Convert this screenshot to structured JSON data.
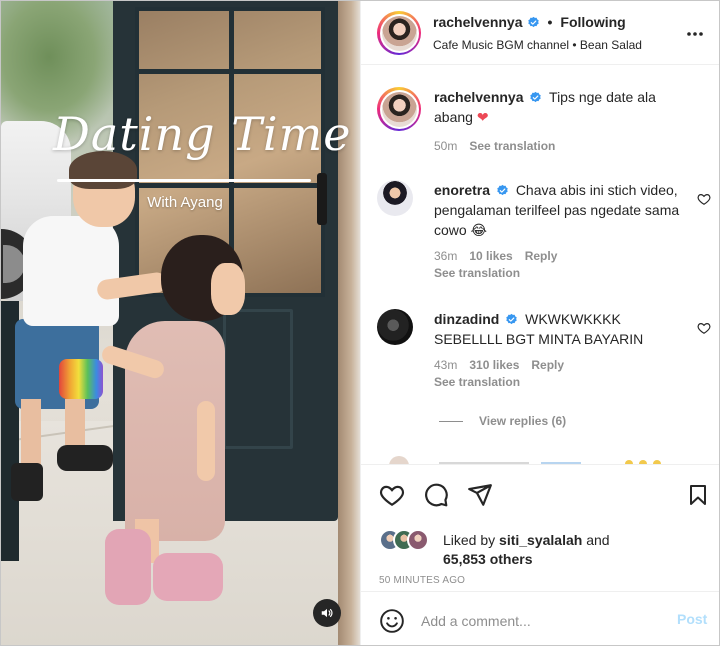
{
  "video": {
    "title": "Dating Time",
    "subtitle": "With Ayang",
    "mute_icon": "speaker-icon"
  },
  "header": {
    "username": "rachelvennyа",
    "separator": "•",
    "follow_label": "Following",
    "audio_line": "Cafe Music BGM channel • Bean Salad",
    "more_icon": "more-horizontal-icon"
  },
  "caption": {
    "username": "rachelvennya",
    "text": "Tips nge date ala abang",
    "emoji": "❤",
    "time": "50m",
    "see_translation": "See translation"
  },
  "comments": [
    {
      "username": "enoretra",
      "text": "Chava abis ini stich video, pengalaman terilfeel pas ngedate sama cowo",
      "emoji": "😂",
      "time": "36m",
      "likes": "10 likes",
      "reply": "Reply",
      "see_translation": "See translation"
    },
    {
      "username": "dinzadind",
      "text": "WKWKWKKKK SEBELLLL BGT MINTA BAYARIN",
      "time": "43m",
      "likes": "310 likes",
      "reply": "Reply",
      "see_translation": "See translation"
    }
  ],
  "view_replies": "View replies (6)",
  "likes": {
    "prefix": "Liked by",
    "user": "siti_syalalah",
    "and": "and",
    "others": "65,853 others"
  },
  "timestamp": "50 MINUTES AGO",
  "add_comment": {
    "placeholder": "Add a comment...",
    "post_label": "Post"
  },
  "colors": {
    "verified": "#3897f0",
    "heart": "#ed4956",
    "post_disabled": "#b2dffc",
    "muted_text": "#8e8e8e"
  }
}
